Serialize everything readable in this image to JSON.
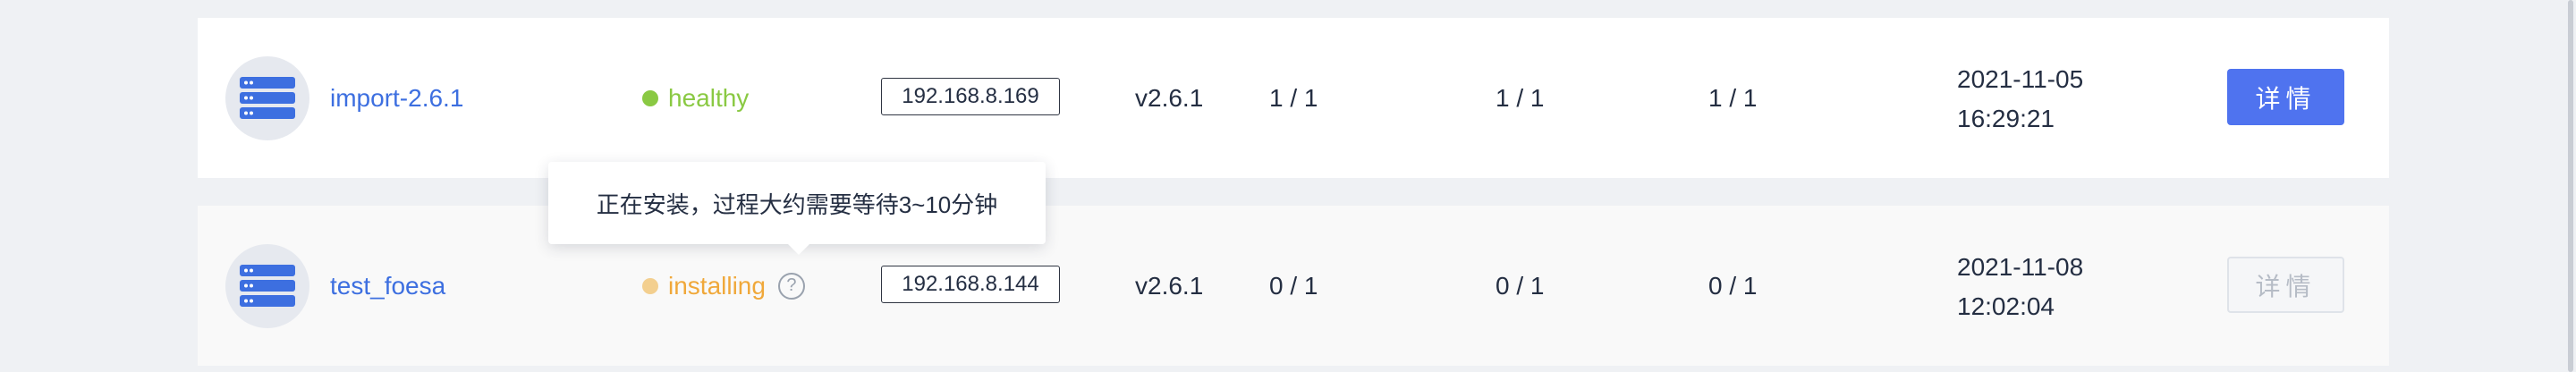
{
  "colors": {
    "link": "#3d6fe0",
    "healthy": "#8ac943",
    "installing": "#f0a83a",
    "primary": "#4f73ef",
    "text": "#242e42"
  },
  "rows": [
    {
      "icon": "cluster-server-icon",
      "name": "import-2.6.1",
      "status": "healthy",
      "ip": "192.168.8.169",
      "version": "v2.6.1",
      "col1": "1 / 1",
      "col2": "1 / 1",
      "col3": "1 / 1",
      "date": "2021-11-05",
      "time": "16:29:21",
      "button": "详情",
      "button_enabled": true
    },
    {
      "icon": "cluster-server-icon",
      "name": "test_foesa",
      "status": "installing",
      "help_icon": "question-circle-icon",
      "ip": "192.168.8.144",
      "version": "v2.6.1",
      "col1": "0 / 1",
      "col2": "0 / 1",
      "col3": "0 / 1",
      "date": "2021-11-08",
      "time": "12:02:04",
      "button": "详情",
      "button_enabled": false
    }
  ],
  "tooltip": {
    "text": "正在安装，过程大约需要等待3~10分钟"
  }
}
